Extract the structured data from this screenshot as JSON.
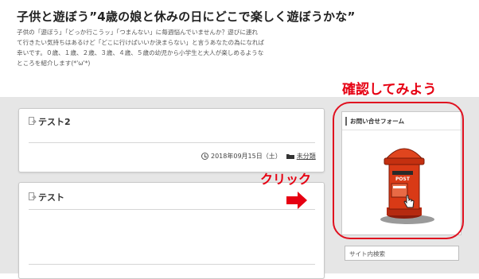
{
  "header": {
    "title": "子供と遊ぼう”4歳の娘と休みの日にどこで楽しく遊ぼうかな”",
    "description_lines": [
      "子供の「遊ぼう」「どっか行こうッ」「つまんない」に毎週悩んでいませんか？遊びに連れ",
      "て行きたい気持ちはあるけど「どこに行けばいいか決まらない」と言うあなたの為になれば",
      "幸いです。０歳、１歳、２歳、３歳、４歳、５歳の幼児から小学生と大人が楽しめるような",
      "ところを紹介します(*'ω'*)"
    ]
  },
  "posts": [
    {
      "title": "テスト2",
      "date": "2018年09月15日（土）",
      "category": "未分類"
    },
    {
      "title": "テスト"
    }
  ],
  "sidebar": {
    "contact_widget_title": "お問い合せフォーム",
    "search_placeholder": "サイト内検索"
  },
  "annotations": {
    "check_label": "確認してみよう",
    "click_label": "クリック"
  },
  "colors": {
    "annotation_red": "#e60012",
    "mailbox_red": "#d93a16",
    "background_gray": "#e6e6e6"
  },
  "icons": {
    "post_title_icon": "document-arrow-icon",
    "date_icon": "clock-icon",
    "category_icon": "folder-icon",
    "widget_image": "mailbox-icon",
    "cursor": "hand-pointer-icon"
  }
}
